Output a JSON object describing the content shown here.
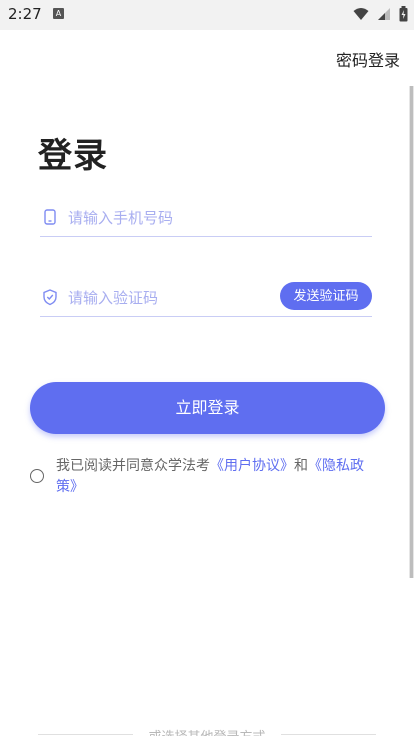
{
  "status_bar": {
    "time": "2:27",
    "notification_icon": "A"
  },
  "header": {
    "password_login": "密码登录"
  },
  "main": {
    "title": "登录",
    "phone_placeholder": "请输入手机号码",
    "code_placeholder": "请输入验证码",
    "send_code": "发送验证码",
    "login_button": "立即登录"
  },
  "agreement": {
    "prefix": "我已阅读并同意众学法考",
    "user_agreement": "《用户协议》",
    "and": "和",
    "privacy_policy": "《隐私政策》"
  },
  "footer": {
    "other_login": "或选择其他登录方式"
  },
  "colors": {
    "accent": "#5f6ef0",
    "placeholder": "#a8aef0"
  }
}
